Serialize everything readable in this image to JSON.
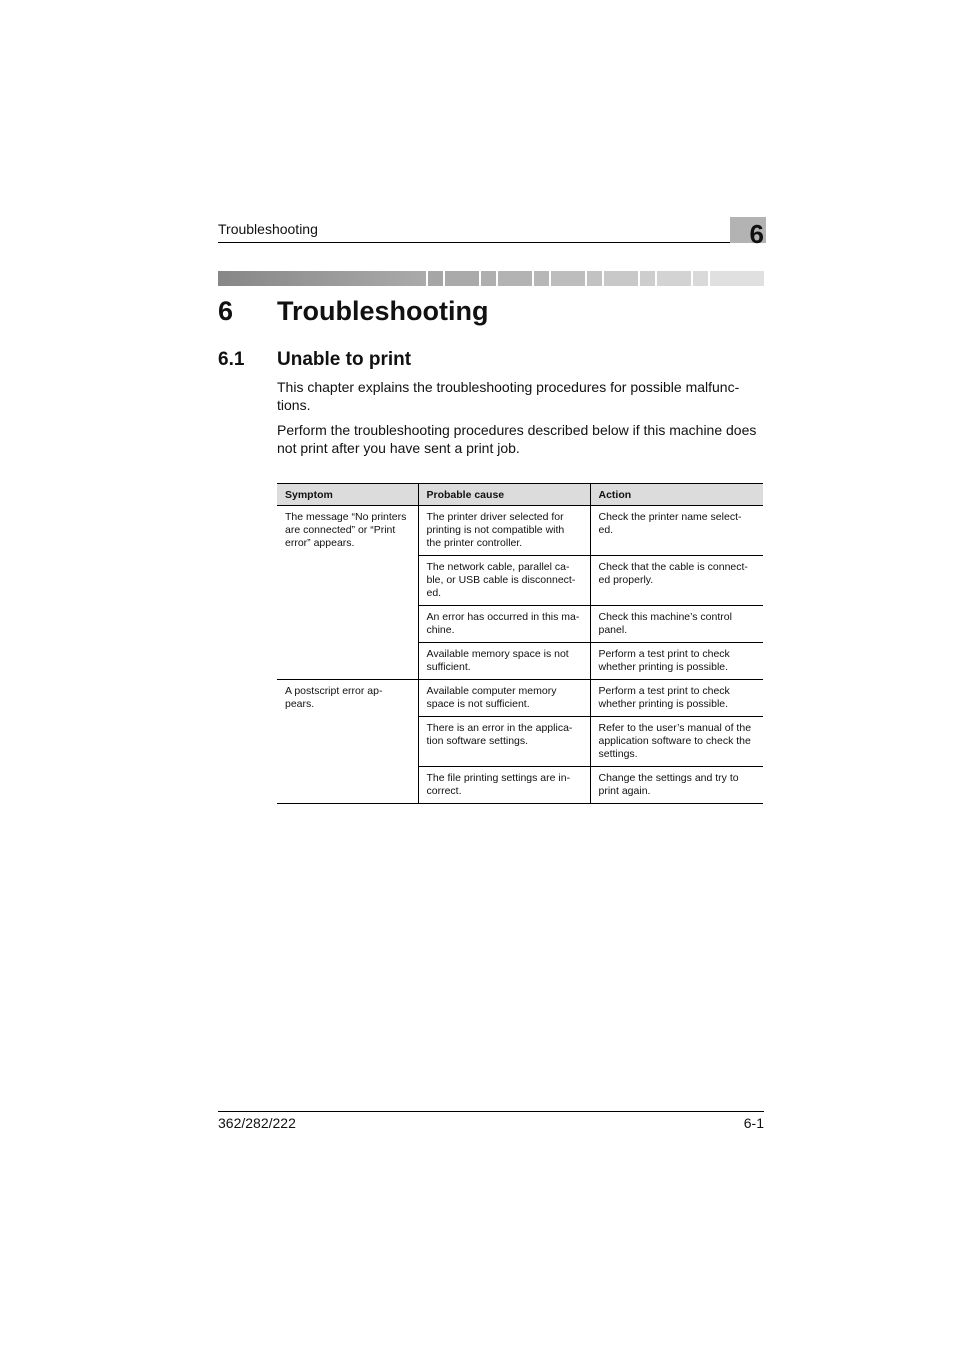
{
  "header": {
    "running_title": "Troubleshooting",
    "chapter_number": "6"
  },
  "band": {
    "segments": [
      "#a6a6a6",
      "#aaaaaa",
      "#afafaf",
      "#b3b3b3",
      "#b7b7b7",
      "#bdbdbd",
      "#c2c2c2",
      "#c8c8c8",
      "#cdcdcd",
      "#d3d3d3",
      "#d9d9d9",
      "#e0e0e0"
    ]
  },
  "chapter": {
    "number": "6",
    "title": "Troubleshooting"
  },
  "section": {
    "number": "6.1",
    "title": "Unable to print",
    "paragraphs": [
      "This chapter explains the troubleshooting procedures for possible malfunc-tions.",
      "Perform the troubleshooting procedures described below if this machine does not print after you have sent a print job."
    ]
  },
  "table": {
    "headers": [
      "Symptom",
      "Probable cause",
      "Action"
    ],
    "groups": [
      {
        "symptom": "The message “No printers are connected” or “Print error” appears.",
        "rows": [
          {
            "cause": "The printer driver selected for printing is not compatible with the printer controller.",
            "action": "Check the printer name select-ed."
          },
          {
            "cause": "The network cable, parallel ca-ble, or USB cable is disconnect-ed.",
            "action": "Check that the cable is connect-ed properly."
          },
          {
            "cause": "An error has occurred in this ma-chine.",
            "action": "Check this machine’s control panel."
          },
          {
            "cause": "Available memory space is not sufficient.",
            "action": "Perform a test print to check whether printing is possible."
          }
        ]
      },
      {
        "symptom": "A postscript error ap-pears.",
        "rows": [
          {
            "cause": "Available computer memory space is not sufficient.",
            "action": "Perform a test print to check whether printing is possible."
          },
          {
            "cause": "There is an error in the applica-tion software settings.",
            "action": "Refer to the user’s manual of the application software to check the settings."
          },
          {
            "cause": "The file printing settings are in-correct.",
            "action": "Change the settings and try to print again."
          }
        ]
      }
    ]
  },
  "footer": {
    "model": "362/282/222",
    "page": "6-1"
  }
}
